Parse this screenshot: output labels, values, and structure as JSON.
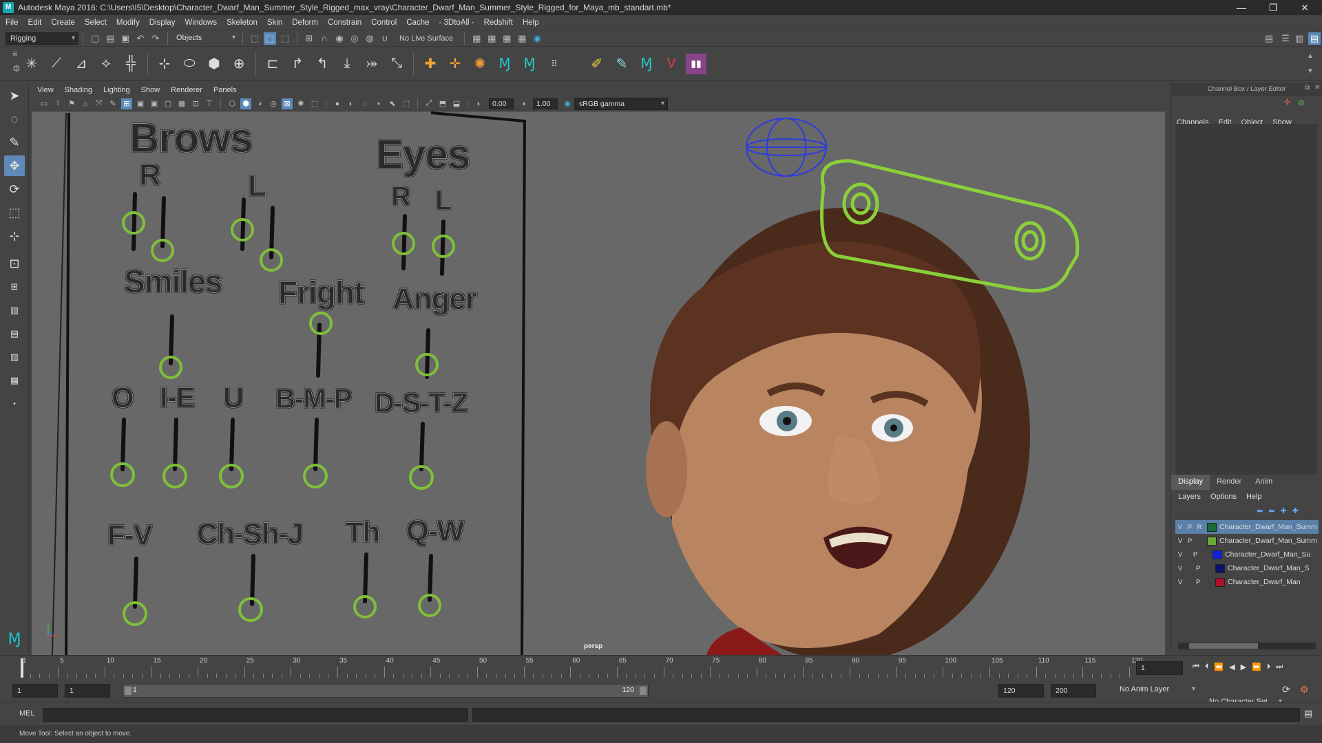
{
  "window": {
    "title": "Autodesk Maya 2016: C:\\Users\\I5\\Desktop\\Character_Dwarf_Man_Summer_Style_Rigged_max_vray\\Character_Dwarf_Man_Summer_Style_Rigged_for_Maya_mb_standart.mb*",
    "minimize": "—",
    "restore": "❐",
    "close": "✕"
  },
  "menubar": [
    "File",
    "Edit",
    "Create",
    "Select",
    "Modify",
    "Display",
    "Windows",
    "Skeleton",
    "Skin",
    "Deform",
    "Constrain",
    "Control",
    "Cache",
    "- 3DtoAll -",
    "Redshift",
    "Help"
  ],
  "statusline": {
    "mode": "Rigging",
    "selection_mode": "Objects",
    "live_surface": "No Live Surface"
  },
  "panel": {
    "menus": [
      "View",
      "Shading",
      "Lighting",
      "Show",
      "Renderer",
      "Panels"
    ],
    "near_value": "0.00",
    "far_value": "1.00",
    "colorspace": "sRGB gamma",
    "camera_label": "persp"
  },
  "face_board": {
    "labels": {
      "brows": "Brows",
      "brows_r": "R",
      "brows_l": "L",
      "eyes": "Eyes",
      "eyes_r": "R",
      "eyes_l": "L",
      "smiles": "Smiles",
      "fright": "Fright",
      "anger": "Anger",
      "o": "O",
      "ie": "I-E",
      "u": "U",
      "bmp": "B-M-P",
      "dstz": "D-S-T-Z",
      "fv": "F-V",
      "chshj": "Ch-Sh-J",
      "th": "Th",
      "qw": "Q-W"
    }
  },
  "channel_box": {
    "header": "Channel Box / Layer Editor",
    "tabs": [
      "Channels",
      "Edit",
      "Object",
      "Show"
    ],
    "layer_tabs": [
      "Display",
      "Render",
      "Anim"
    ],
    "layer_menu": [
      "Layers",
      "Options",
      "Help"
    ],
    "layers": [
      {
        "v": "V",
        "p": "P",
        "r": "R",
        "color": "#1a6b3a",
        "name": "Character_Dwarf_Man_Summ",
        "selected": true
      },
      {
        "v": "V",
        "p": "P",
        "r": "",
        "color": "#6aa83a",
        "name": "Character_Dwarf_Man_Summ",
        "selected": false
      },
      {
        "v": "V",
        "p": "P",
        "r": "",
        "color": "#1020e0",
        "name": "Character_Dwarf_Man_Su",
        "selected": false
      },
      {
        "v": "V",
        "p": "P",
        "r": "",
        "color": "#101070",
        "name": "Character_Dwarf_Man_S",
        "selected": false
      },
      {
        "v": "V",
        "p": "P",
        "r": "",
        "color": "#b01030",
        "name": "Character_Dwarf_Man",
        "selected": false
      }
    ]
  },
  "timeline": {
    "ticks": [
      "1",
      "5",
      "10",
      "15",
      "20",
      "25",
      "30",
      "35",
      "40",
      "45",
      "50",
      "55",
      "60",
      "65",
      "70",
      "75",
      "80",
      "85",
      "90",
      "95",
      "100",
      "105",
      "110",
      "115",
      "120"
    ],
    "current_frame": "1"
  },
  "range": {
    "start": "1",
    "playback_start": "1",
    "slider_start": "1",
    "slider_end": "120",
    "playback_end": "120",
    "end": "200",
    "anim_layer": "No Anim Layer",
    "character_set": "No Character Set"
  },
  "command": {
    "lang": "MEL"
  },
  "help_line": "Move Tool: Select an object to move."
}
